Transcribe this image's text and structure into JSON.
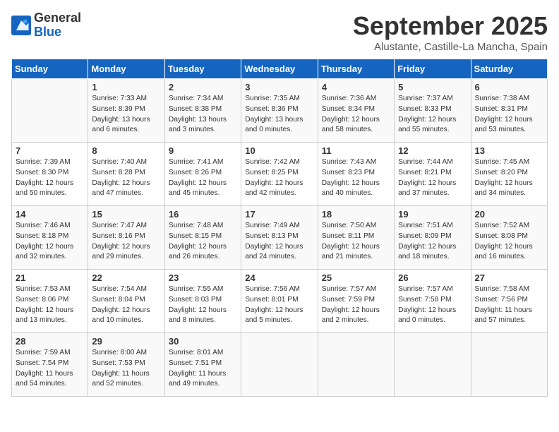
{
  "header": {
    "logo_general": "General",
    "logo_blue": "Blue",
    "month_title": "September 2025",
    "subtitle": "Alustante, Castille-La Mancha, Spain"
  },
  "days_of_week": [
    "Sunday",
    "Monday",
    "Tuesday",
    "Wednesday",
    "Thursday",
    "Friday",
    "Saturday"
  ],
  "weeks": [
    [
      {
        "day": "",
        "content": ""
      },
      {
        "day": "1",
        "content": "Sunrise: 7:33 AM\nSunset: 8:39 PM\nDaylight: 13 hours\nand 6 minutes."
      },
      {
        "day": "2",
        "content": "Sunrise: 7:34 AM\nSunset: 8:38 PM\nDaylight: 13 hours\nand 3 minutes."
      },
      {
        "day": "3",
        "content": "Sunrise: 7:35 AM\nSunset: 8:36 PM\nDaylight: 13 hours\nand 0 minutes."
      },
      {
        "day": "4",
        "content": "Sunrise: 7:36 AM\nSunset: 8:34 PM\nDaylight: 12 hours\nand 58 minutes."
      },
      {
        "day": "5",
        "content": "Sunrise: 7:37 AM\nSunset: 8:33 PM\nDaylight: 12 hours\nand 55 minutes."
      },
      {
        "day": "6",
        "content": "Sunrise: 7:38 AM\nSunset: 8:31 PM\nDaylight: 12 hours\nand 53 minutes."
      }
    ],
    [
      {
        "day": "7",
        "content": "Sunrise: 7:39 AM\nSunset: 8:30 PM\nDaylight: 12 hours\nand 50 minutes."
      },
      {
        "day": "8",
        "content": "Sunrise: 7:40 AM\nSunset: 8:28 PM\nDaylight: 12 hours\nand 47 minutes."
      },
      {
        "day": "9",
        "content": "Sunrise: 7:41 AM\nSunset: 8:26 PM\nDaylight: 12 hours\nand 45 minutes."
      },
      {
        "day": "10",
        "content": "Sunrise: 7:42 AM\nSunset: 8:25 PM\nDaylight: 12 hours\nand 42 minutes."
      },
      {
        "day": "11",
        "content": "Sunrise: 7:43 AM\nSunset: 8:23 PM\nDaylight: 12 hours\nand 40 minutes."
      },
      {
        "day": "12",
        "content": "Sunrise: 7:44 AM\nSunset: 8:21 PM\nDaylight: 12 hours\nand 37 minutes."
      },
      {
        "day": "13",
        "content": "Sunrise: 7:45 AM\nSunset: 8:20 PM\nDaylight: 12 hours\nand 34 minutes."
      }
    ],
    [
      {
        "day": "14",
        "content": "Sunrise: 7:46 AM\nSunset: 8:18 PM\nDaylight: 12 hours\nand 32 minutes."
      },
      {
        "day": "15",
        "content": "Sunrise: 7:47 AM\nSunset: 8:16 PM\nDaylight: 12 hours\nand 29 minutes."
      },
      {
        "day": "16",
        "content": "Sunrise: 7:48 AM\nSunset: 8:15 PM\nDaylight: 12 hours\nand 26 minutes."
      },
      {
        "day": "17",
        "content": "Sunrise: 7:49 AM\nSunset: 8:13 PM\nDaylight: 12 hours\nand 24 minutes."
      },
      {
        "day": "18",
        "content": "Sunrise: 7:50 AM\nSunset: 8:11 PM\nDaylight: 12 hours\nand 21 minutes."
      },
      {
        "day": "19",
        "content": "Sunrise: 7:51 AM\nSunset: 8:09 PM\nDaylight: 12 hours\nand 18 minutes."
      },
      {
        "day": "20",
        "content": "Sunrise: 7:52 AM\nSunset: 8:08 PM\nDaylight: 12 hours\nand 16 minutes."
      }
    ],
    [
      {
        "day": "21",
        "content": "Sunrise: 7:53 AM\nSunset: 8:06 PM\nDaylight: 12 hours\nand 13 minutes."
      },
      {
        "day": "22",
        "content": "Sunrise: 7:54 AM\nSunset: 8:04 PM\nDaylight: 12 hours\nand 10 minutes."
      },
      {
        "day": "23",
        "content": "Sunrise: 7:55 AM\nSunset: 8:03 PM\nDaylight: 12 hours\nand 8 minutes."
      },
      {
        "day": "24",
        "content": "Sunrise: 7:56 AM\nSunset: 8:01 PM\nDaylight: 12 hours\nand 5 minutes."
      },
      {
        "day": "25",
        "content": "Sunrise: 7:57 AM\nSunset: 7:59 PM\nDaylight: 12 hours\nand 2 minutes."
      },
      {
        "day": "26",
        "content": "Sunrise: 7:57 AM\nSunset: 7:58 PM\nDaylight: 12 hours\nand 0 minutes."
      },
      {
        "day": "27",
        "content": "Sunrise: 7:58 AM\nSunset: 7:56 PM\nDaylight: 11 hours\nand 57 minutes."
      }
    ],
    [
      {
        "day": "28",
        "content": "Sunrise: 7:59 AM\nSunset: 7:54 PM\nDaylight: 11 hours\nand 54 minutes."
      },
      {
        "day": "29",
        "content": "Sunrise: 8:00 AM\nSunset: 7:53 PM\nDaylight: 11 hours\nand 52 minutes."
      },
      {
        "day": "30",
        "content": "Sunrise: 8:01 AM\nSunset: 7:51 PM\nDaylight: 11 hours\nand 49 minutes."
      },
      {
        "day": "",
        "content": ""
      },
      {
        "day": "",
        "content": ""
      },
      {
        "day": "",
        "content": ""
      },
      {
        "day": "",
        "content": ""
      }
    ]
  ]
}
